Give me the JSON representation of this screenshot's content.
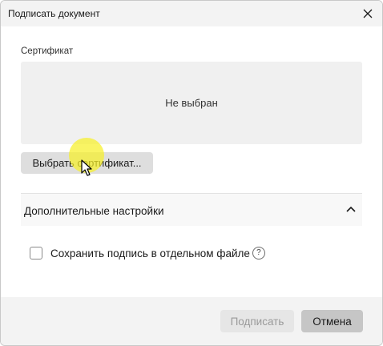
{
  "window": {
    "title": "Подписать документ"
  },
  "certificate": {
    "label": "Сертификат",
    "status": "Не выбран",
    "choose_label": "Выбрать сертификат..."
  },
  "extra": {
    "header": "Дополнительные настройки",
    "save_separate_label": "Сохранить подпись в отдельном файле",
    "save_separate_checked": false,
    "help_glyph": "?"
  },
  "footer": {
    "sign_label": "Подписать",
    "cancel_label": "Отмена"
  },
  "icons": {
    "close": "close-icon",
    "chevron": "chevron-up-icon",
    "help": "help-icon"
  },
  "colors": {
    "cursor_highlight": "#f7f028"
  }
}
